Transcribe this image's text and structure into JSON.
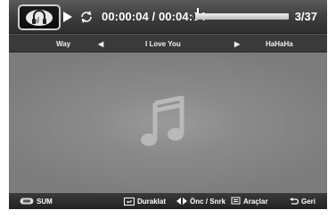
{
  "player": {
    "time": "00:00:04 / 00:04:04",
    "progress_fraction": 0.016,
    "counter": "3/37"
  },
  "tracks": {
    "previous": "Way",
    "current": "I Love You",
    "next": "HaHaHa"
  },
  "bottom_bar": {
    "sum_label": "SUM",
    "pause_label": "Duraklat",
    "prev_next_label": "Önc / Snrk",
    "tools_label": "Araçlar",
    "back_label": "Geri"
  },
  "icons": {
    "mode": "headphones-music-icon",
    "play": "play-icon",
    "repeat": "repeat-icon",
    "art": "music-note-icon"
  }
}
